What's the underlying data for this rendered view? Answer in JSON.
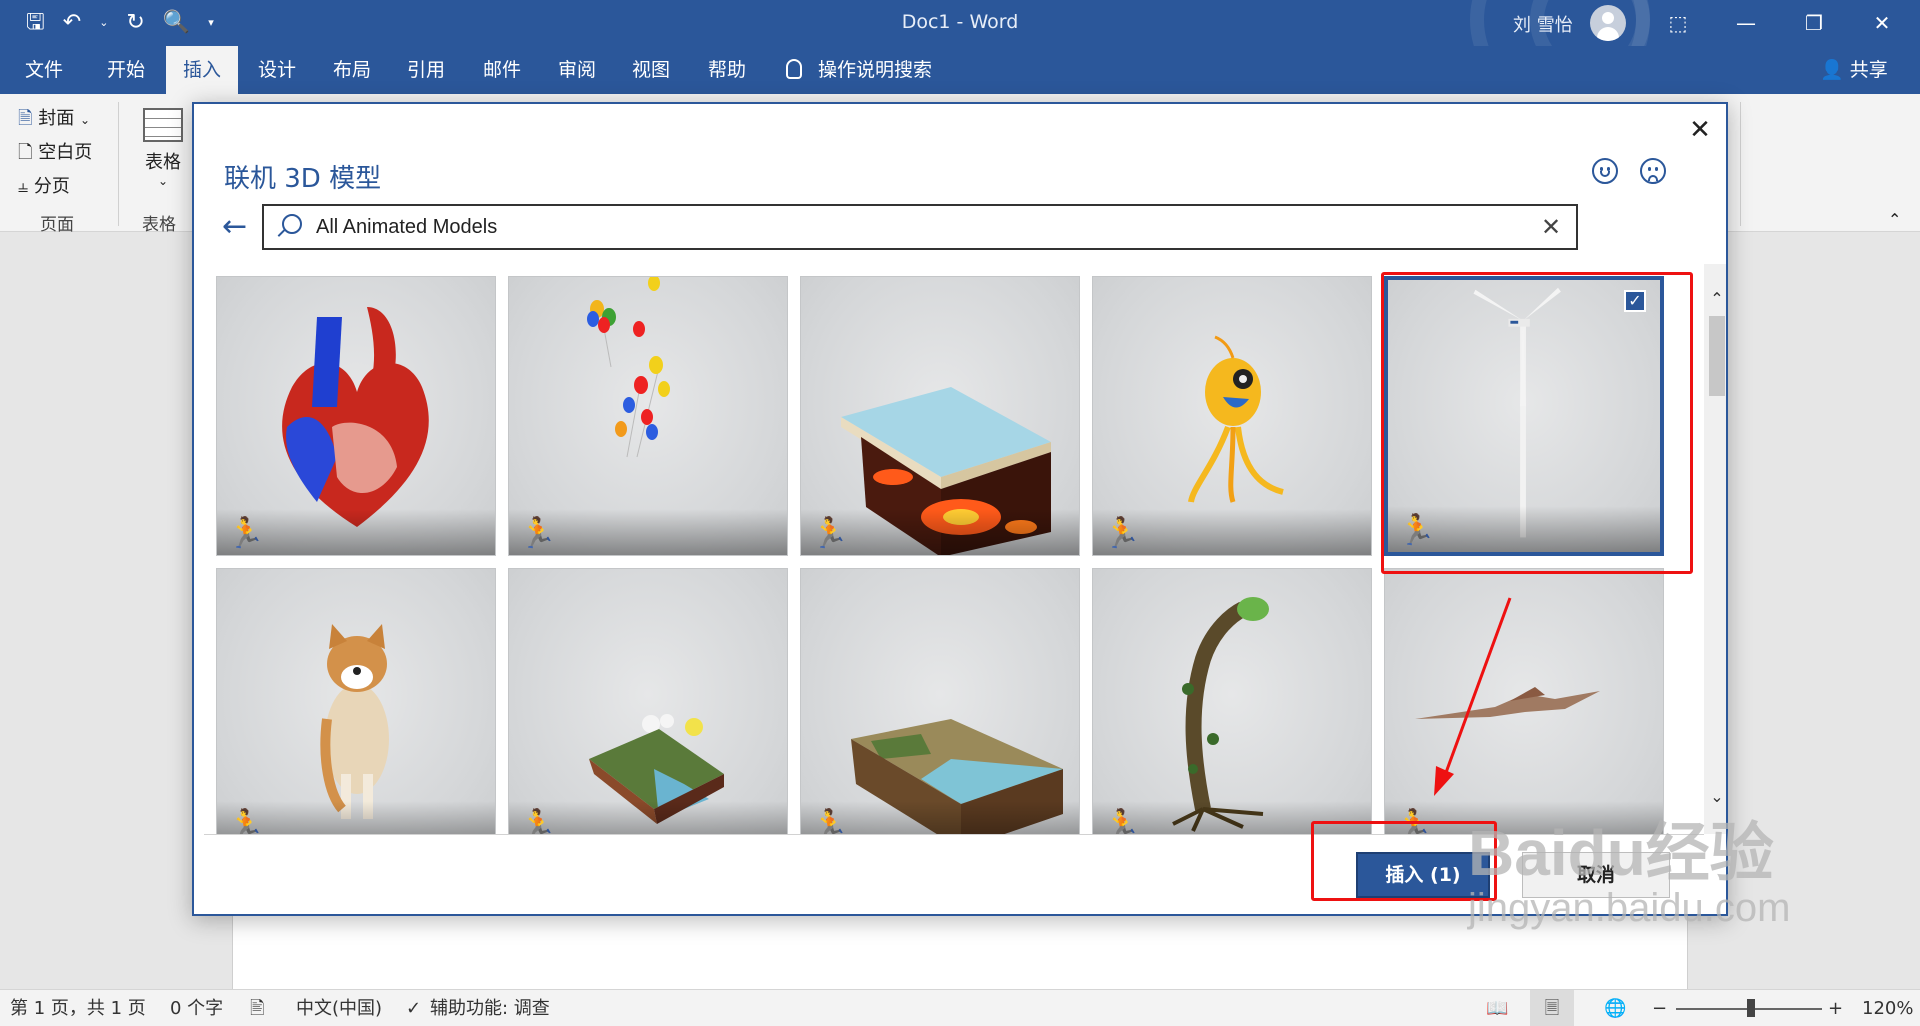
{
  "window": {
    "title": "Doc1  -  Word",
    "user": "刘 雪怡"
  },
  "quick_access": [
    "save-icon",
    "undo-icon",
    "redo-icon",
    "print-preview-icon",
    "customize-icon"
  ],
  "ribbon": {
    "tabs": [
      "文件",
      "开始",
      "插入",
      "设计",
      "布局",
      "引用",
      "邮件",
      "审阅",
      "视图",
      "帮助"
    ],
    "active_tab": "插入",
    "tell_me": "操作说明搜索",
    "share": "共享",
    "pages_group": {
      "cover": "封面",
      "blank": "空白页",
      "break": "分页",
      "label": "页面"
    },
    "table_group": {
      "table": "表格",
      "label": "表格"
    }
  },
  "dialog": {
    "title": "联机 3D 模型",
    "search": {
      "value": "All Animated Models"
    },
    "models": [
      {
        "name": "heart-model",
        "animated": true,
        "selected": false
      },
      {
        "name": "balloons-model",
        "animated": true,
        "selected": false
      },
      {
        "name": "lava-block-model",
        "animated": true,
        "selected": false
      },
      {
        "name": "yellow-creature-model",
        "animated": true,
        "selected": false
      },
      {
        "name": "wind-turbine-model",
        "animated": true,
        "selected": true
      },
      {
        "name": "shiba-dog-model",
        "animated": true,
        "selected": false
      },
      {
        "name": "waterfall-terrain-model",
        "animated": true,
        "selected": false
      },
      {
        "name": "coast-terrain-model",
        "animated": true,
        "selected": false
      },
      {
        "name": "carnivorous-plant-model",
        "animated": true,
        "selected": false
      },
      {
        "name": "pterodactyl-model",
        "animated": true,
        "selected": false
      }
    ],
    "insert_label": "插入 (1)",
    "cancel_label": "取消"
  },
  "statusbar": {
    "page": "第 1 页，共 1 页",
    "words": "0 个字",
    "language": "中文(中国)",
    "accessibility": "辅助功能: 调查",
    "zoom": "120%"
  },
  "watermark": {
    "logo": "Baidu经验",
    "url": "jingyan.baidu.com"
  },
  "colors": {
    "accent": "#2b579a",
    "annotation": "#ee1111"
  }
}
